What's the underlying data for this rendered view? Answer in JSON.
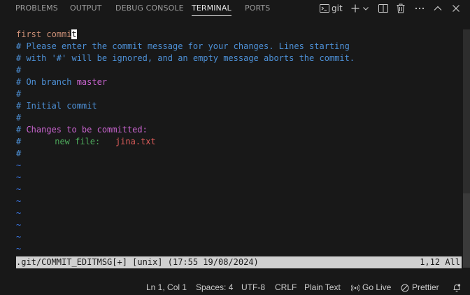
{
  "panel": {
    "tabs": [
      {
        "label": "PROBLEMS",
        "active": false
      },
      {
        "label": "OUTPUT",
        "active": false
      },
      {
        "label": "DEBUG CONSOLE",
        "active": false
      },
      {
        "label": "TERMINAL",
        "active": true
      },
      {
        "label": "PORTS",
        "active": false
      }
    ],
    "terminal_name": "git",
    "action_icons": [
      "terminal-icon",
      "plus-icon",
      "chevron-down-icon",
      "split-icon",
      "trash-icon",
      "ellipsis-icon",
      "chevron-up-icon",
      "close-icon"
    ]
  },
  "editor": {
    "commit_message_start": "first commi",
    "commit_message_cursor_char": "t",
    "comment_line_1": "# Please enter the commit message for your changes. Lines starting",
    "comment_line_2": "# with '#' will be ignored, and an empty message aborts the commit.",
    "hash": "#",
    "branch_prefix": "# On branch ",
    "branch_name": "master",
    "initial_commit": "# Initial commit",
    "changes_hash": "# ",
    "changes_heading": "Changes to be committed:",
    "new_file_indent": "#\t",
    "new_file_label": "new file:",
    "new_file_gap": "   ",
    "new_file_name": "jina.txt",
    "tilde": "~",
    "status_left": ".git/COMMIT_EDITMSG[+] [unix] (17:55 19/08/2024)",
    "status_right": "1,12 All"
  },
  "statusbar": {
    "position": "Ln 1, Col 1",
    "spaces": "Spaces: 4",
    "encoding": "UTF-8",
    "eol": "CRLF",
    "language": "Plain Text",
    "go_live": "Go Live",
    "prettier": "Prettier",
    "icons": [
      "broadcast-icon",
      "prettier-check-icon",
      "bell-icon"
    ]
  },
  "colors": {
    "background": "#181818",
    "text_orange": "#ce9178",
    "comment_blue": "#4d90d6",
    "branch_magenta": "#c964cf",
    "new_file_green": "#4eab5c",
    "file_red": "#d95b59",
    "tilde_blue": "#3b78e7",
    "statusline_bg": "#d0d0d0"
  }
}
